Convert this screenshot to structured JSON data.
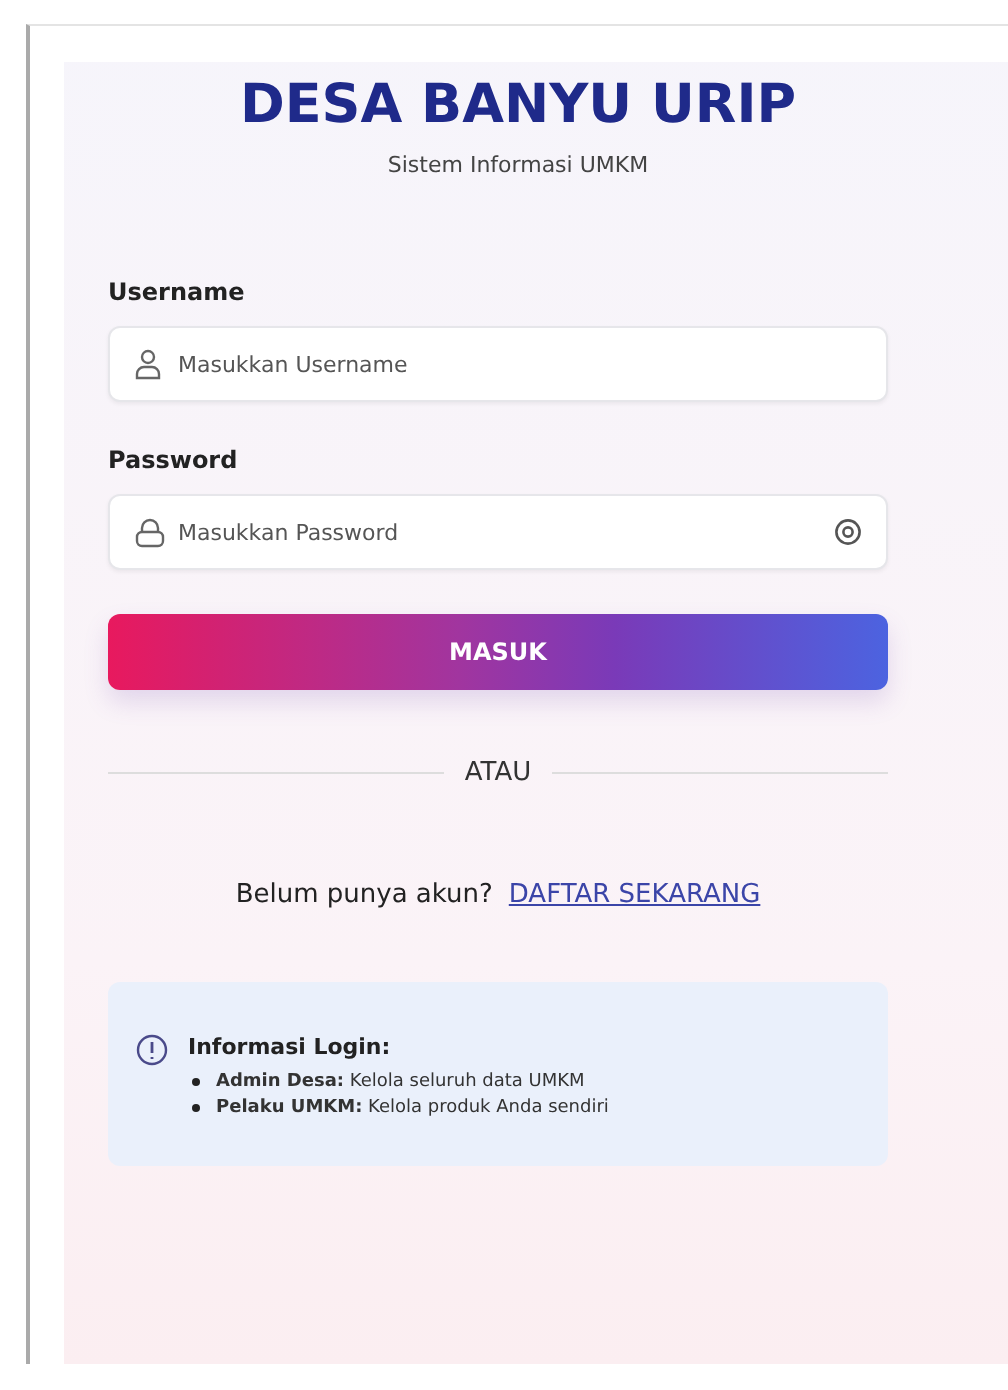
{
  "header": {
    "title": "DESA BANYU URIP",
    "subtitle": "Sistem Informasi UMKM"
  },
  "fields": [
    {
      "label": "Username",
      "placeholder": "Masukkan Username",
      "kind": "user"
    },
    {
      "label": "Password",
      "placeholder": "Masukkan Password",
      "kind": "password"
    }
  ],
  "submit_button": "MASUK",
  "divider_text": "ATAU",
  "register": {
    "prompt": "Belum punya akun?",
    "link": "DAFTAR SEKARANG"
  },
  "info": {
    "title": "Informasi Login:",
    "items": [
      "**Admin Desa:** Kelola seluruh data UMKM",
      "**Pelaku UMKM:** Kelola produk Anda sendiri"
    ]
  }
}
